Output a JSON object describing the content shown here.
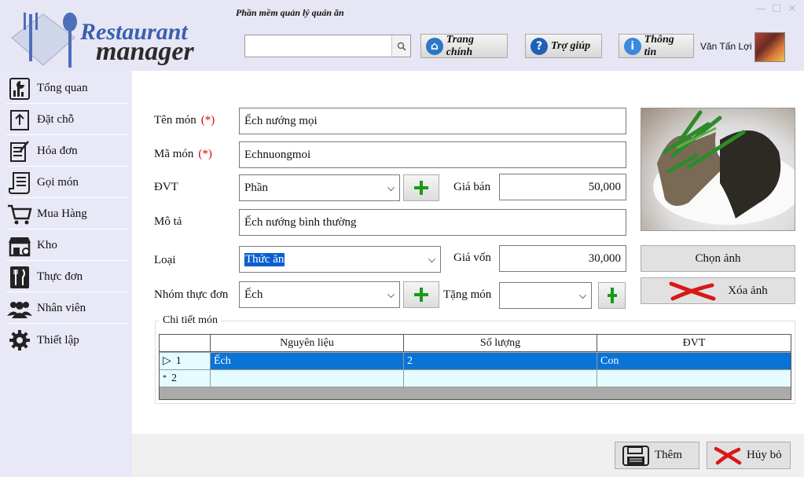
{
  "header": {
    "app_title": "Phần mềm quản lý quán ăn",
    "logo_line1": "Restaurant",
    "logo_line2": "manager",
    "search": {
      "value": "",
      "placeholder": ""
    },
    "buttons": {
      "home": "Trang chính",
      "help": "Trợ giúp",
      "info": "Thông tin"
    },
    "user_name": "Văn Tấn Lợi"
  },
  "sidebar": {
    "items": [
      {
        "label": "Tổng quan",
        "icon": "dashboard-icon"
      },
      {
        "label": "Đặt chỗ",
        "icon": "upload-box-icon"
      },
      {
        "label": "Hóa đơn",
        "icon": "invoice-icon"
      },
      {
        "label": "Gọi món",
        "icon": "order-list-icon"
      },
      {
        "label": "Mua Hàng",
        "icon": "cart-icon"
      },
      {
        "label": "Kho",
        "icon": "warehouse-icon"
      },
      {
        "label": "Thực đơn",
        "icon": "menu-fork-knife-icon"
      },
      {
        "label": "Nhân viên",
        "icon": "people-icon"
      },
      {
        "label": "Thiết lập",
        "icon": "gear-icon"
      }
    ]
  },
  "form": {
    "labels": {
      "dish_name": "Tên món",
      "dish_code": "Mã món",
      "unit": "ĐVT",
      "sale_price": "Giá bán",
      "description": "Mô tả",
      "category": "Loại",
      "cost_price": "Giá vốn",
      "menu_group": "Nhóm thực đơn",
      "gift_dish": "Tặng món",
      "required_mark": "(*)"
    },
    "values": {
      "dish_name": "Ếch nướng mọi",
      "dish_code": "Echnuongmoi",
      "unit": "Phần",
      "sale_price": "50,000",
      "description": "Ếch nướng bình thường",
      "category": "Thức ăn",
      "cost_price": "30,000",
      "menu_group": "Ếch",
      "gift_dish": ""
    },
    "image_buttons": {
      "choose": "Chọn ảnh",
      "delete": "Xóa ảnh"
    }
  },
  "details": {
    "legend": "Chi tiết món",
    "columns": [
      "Nguyên liệu",
      "Số lượng",
      "ĐVT"
    ],
    "rows": [
      {
        "index": "1",
        "ingredient": "Ếch",
        "quantity": "2",
        "unit": "Con"
      },
      {
        "index": "2",
        "ingredient": "",
        "quantity": "",
        "unit": ""
      }
    ]
  },
  "footer": {
    "add": "Thêm",
    "cancel": "Hủy bỏ"
  },
  "colors": {
    "selection": "#0a73d6",
    "required": "#dd0000",
    "plus_green": "#1a9a1a",
    "delete_red": "#d81818"
  }
}
